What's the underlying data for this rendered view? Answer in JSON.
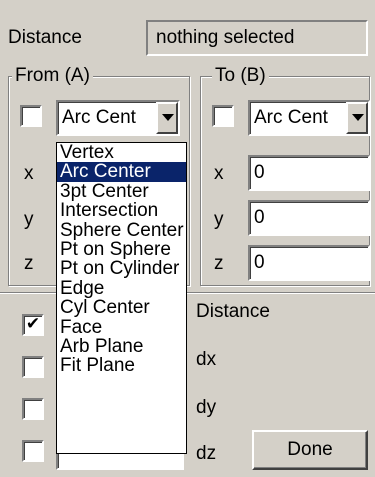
{
  "header": {
    "distance_label": "Distance",
    "status_value": "nothing selected"
  },
  "from_group": {
    "title": "From (A)",
    "checked": false,
    "combo_value": "Arc Cent",
    "x_label": "x",
    "y_label": "y",
    "z_label": "z"
  },
  "to_group": {
    "title": "To (B)",
    "checked": false,
    "combo_value": "Arc Cent",
    "x_label": "x",
    "x_value": "0",
    "y_label": "y",
    "y_value": "0",
    "z_label": "z",
    "z_value": "0"
  },
  "dropdown": {
    "items": [
      "Vertex",
      "Arc Center",
      "3pt Center",
      "Intersection",
      "Sphere Center",
      "Pt on Sphere",
      "Pt on Cylinder",
      "Edge",
      "Cyl Center",
      "Face",
      "Arb Plane",
      "Fit Plane"
    ],
    "selected": "Arc Center"
  },
  "results": {
    "distance_checked": true,
    "dx_checked": false,
    "dy_checked": false,
    "dz_checked": false,
    "distance_label": "Distance",
    "dx_label": "dx",
    "dy_label": "dy",
    "dz_label": "dz"
  },
  "done_button": "Done",
  "check_glyph": "✔",
  "colors": {
    "face": "#d4d0c8",
    "selection": "#0a246a"
  }
}
